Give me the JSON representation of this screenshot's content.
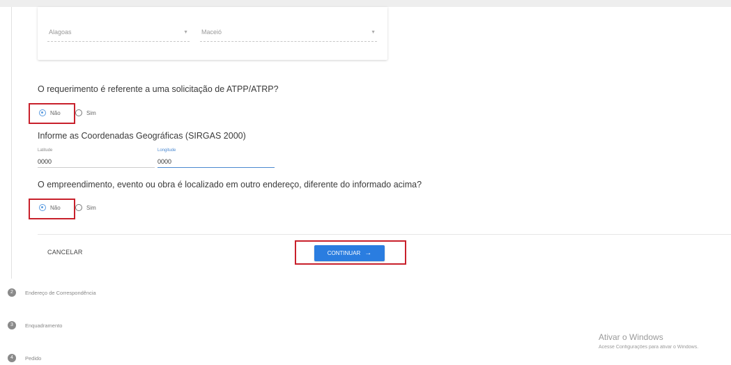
{
  "address": {
    "state_value": "Alagoas",
    "city_value": "Maceió"
  },
  "question_atpp": {
    "text": "O requerimento é referente a uma solicitação de ATPP/ATRP?",
    "option_no": "Não",
    "option_yes": "Sim",
    "selected": "Não"
  },
  "coordinates": {
    "title": "Informe as Coordenadas Geográficas (SIRGAS 2000)",
    "latitude_label": "Latitude",
    "latitude_value": "0000",
    "longitude_label": "Longitude",
    "longitude_value": "0000"
  },
  "question_location": {
    "text": "O empreendimento, evento ou obra é localizado em outro endereço, diferente do informado acima?",
    "option_no": "Não",
    "option_yes": "Sim",
    "selected": "Não"
  },
  "actions": {
    "cancel_label": "CANCELAR",
    "continue_label": "CONTINUAR",
    "continue_arrow": "→"
  },
  "steps": [
    {
      "number": "2",
      "label": "Endereço de Correspondência"
    },
    {
      "number": "3",
      "label": "Enquadramento"
    },
    {
      "number": "4",
      "label": "Pedido"
    }
  ],
  "watermark": {
    "title": "Ativar o Windows",
    "subtitle": "Acesse Configurações para ativar o Windows."
  },
  "colors": {
    "primary": "#2a7de0",
    "highlight": "#c8202b",
    "radio_checked": "#5a9be0"
  }
}
